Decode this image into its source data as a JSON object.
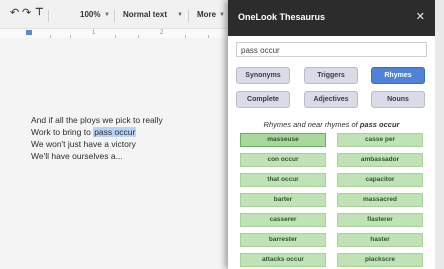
{
  "toolbar": {
    "undo": "↶",
    "redo": "↷",
    "paint": "⊤",
    "zoom": "100%",
    "style": "Normal text",
    "more": "More",
    "ruler": [
      "1",
      "2"
    ]
  },
  "document": {
    "lines": [
      {
        "before": "And if all the ploys we pick to really",
        "hl": "",
        "after": ""
      },
      {
        "before": "Work to bring to ",
        "hl": "pass occur",
        "after": ""
      },
      {
        "before": "We won't just have a victory",
        "hl": "",
        "after": ""
      },
      {
        "before": "We'll have ourselves a...",
        "hl": "",
        "after": ""
      }
    ]
  },
  "panel": {
    "title": "OneLook Thesaurus",
    "close": "✕",
    "search_value": "pass occur",
    "buttons": [
      "Synonyms",
      "Triggers",
      "Rhymes",
      "Complete",
      "Adjectives",
      "Nouns"
    ],
    "active_button": "Rhymes",
    "heading_prefix": "Rhymes and near rhymes of",
    "heading_term": "pass occur",
    "results_left": [
      "masseuse",
      "con occur",
      "that occur",
      "barter",
      "casserer",
      "barrester",
      "attacks occur"
    ],
    "results_right": [
      "casse per",
      "ambassador",
      "capacitor",
      "massacred",
      "flasterer",
      "haster",
      "plackscre"
    ]
  },
  "colors": {
    "accent": "#4f83d8",
    "header": "#2c2c2c",
    "rhyme_cell": "#bfe3b5",
    "highlight": "#b8d3f5"
  }
}
